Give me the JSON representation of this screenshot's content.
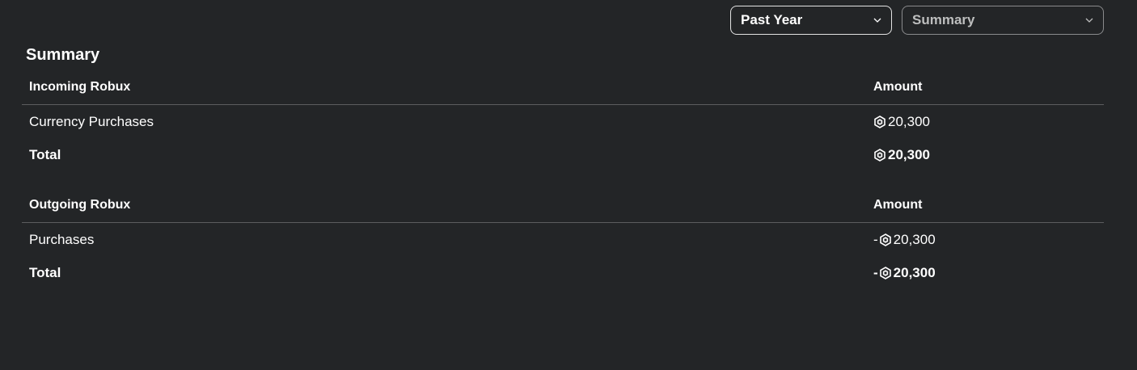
{
  "filters": {
    "period": "Past Year",
    "view": "Summary"
  },
  "summary": {
    "title": "Summary",
    "incoming": {
      "header_label": "Incoming Robux",
      "header_amount": "Amount",
      "rows": [
        {
          "label": "Currency Purchases",
          "amount": "20,300"
        }
      ],
      "total": {
        "label": "Total",
        "amount": "20,300"
      }
    },
    "outgoing": {
      "header_label": "Outgoing Robux",
      "header_amount": "Amount",
      "rows": [
        {
          "label": "Purchases",
          "sign": "-",
          "amount": "20,300"
        }
      ],
      "total": {
        "label": "Total",
        "sign": "-",
        "amount": "20,300"
      }
    }
  },
  "icons": {
    "robux": "robux-icon",
    "dropdown": "chevron-down-icon"
  },
  "colors": {
    "background": "#232527",
    "text": "#ffffff",
    "muted": "#bdbebe",
    "divider": "#5c5d5f"
  }
}
